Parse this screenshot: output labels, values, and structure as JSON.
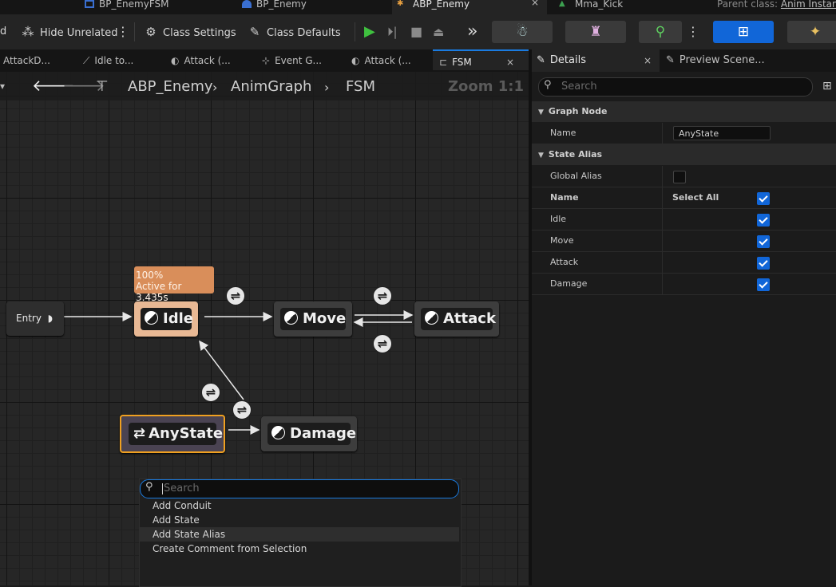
{
  "asset_tabs": [
    {
      "label": "BP_EnemyFSM",
      "icon": "blueprint-icon"
    },
    {
      "label": "BP_Enemy",
      "icon": "blueprint-icon"
    },
    {
      "label": "ABP_Enemy",
      "icon": "anim-blueprint-icon"
    },
    {
      "label": "Mma_Kick",
      "icon": "animation-icon"
    }
  ],
  "parent_class_label": "Parent class:",
  "parent_class_value": "Anim Instance",
  "toolbar": {
    "left_partial": "d",
    "hide_unrelated": "Hide Unrelated",
    "class_settings": "Class Settings",
    "class_defaults": "Class Defaults"
  },
  "doc_tabs": [
    "AttackD...",
    "Idle to...",
    "Attack (...",
    "Event G...",
    "Attack (...",
    "FSM"
  ],
  "breadcrumb": [
    "ABP_Enemy",
    "AnimGraph",
    "FSM"
  ],
  "zoom_label": "Zoom 1:1",
  "graph": {
    "entry": "Entry",
    "states": {
      "idle": "Idle",
      "move": "Move",
      "attack": "Attack",
      "anystate": "AnyState",
      "damage": "Damage"
    },
    "idle_debug": {
      "weight": "100%",
      "active": "Active for 3.435s"
    }
  },
  "context_menu": {
    "search_placeholder": "Search",
    "items": [
      "Add Conduit",
      "Add State",
      "Add State Alias",
      "Create Comment from Selection"
    ],
    "highlight_index": 2
  },
  "details": {
    "tabs": [
      "Details",
      "Preview Scene..."
    ],
    "search_placeholder": "Search",
    "graph_node_header": "Graph Node",
    "name_label": "Name",
    "name_value": "AnyState",
    "state_alias_header": "State Alias",
    "global_alias_label": "Global Alias",
    "global_alias_checked": false,
    "name_col_header": "Name",
    "select_all_label": "Select All",
    "select_all_checked": true,
    "states": [
      {
        "label": "Idle",
        "checked": true
      },
      {
        "label": "Move",
        "checked": true
      },
      {
        "label": "Attack",
        "checked": true
      },
      {
        "label": "Damage",
        "checked": true
      }
    ]
  },
  "colors": {
    "accent_blue": "#1166d8",
    "active_state_fill": "#e8b894",
    "selected_outline": "#f0a020",
    "debug_bubble": "#d98e5a"
  }
}
